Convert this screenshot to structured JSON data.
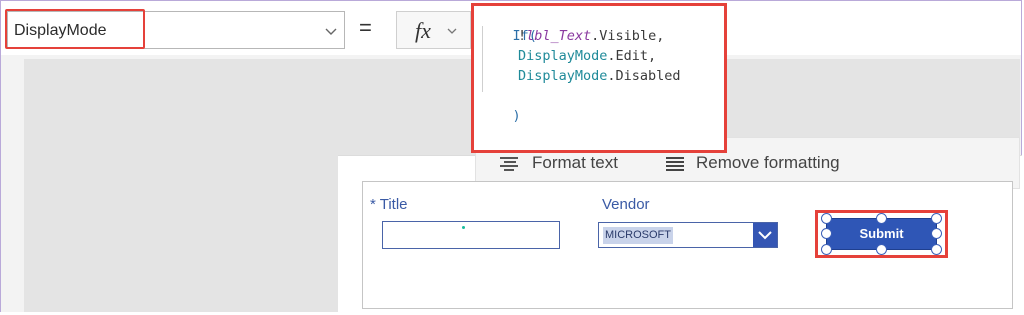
{
  "formula_bar": {
    "property_value": "DisplayMode",
    "equals": "=",
    "fx_label": "fx"
  },
  "code": {
    "line1": "If(",
    "line2_prefix": "!",
    "line2_var": "lbl_Text",
    "line2_suffix": ".Visible,",
    "line3_enum": "DisplayMode",
    "line3_suffix": ".Edit,",
    "line4_enum": "DisplayMode",
    "line4_suffix": ".Disabled",
    "line5": ")"
  },
  "toolbar": {
    "format_text": "Format text",
    "remove_formatting": "Remove formatting"
  },
  "form": {
    "title_label": "* Title",
    "vendor_label": "Vendor",
    "vendor_value": "MICROSOFT",
    "submit_label": "Submit"
  },
  "colors": {
    "highlight": "#e5413a",
    "button": "#2f56b6",
    "label": "#3a5aa5"
  },
  "icons": [
    "chevron-down-icon",
    "fx-icon",
    "format-text-icon",
    "remove-formatting-icon",
    "dropdown-chevron-icon"
  ]
}
